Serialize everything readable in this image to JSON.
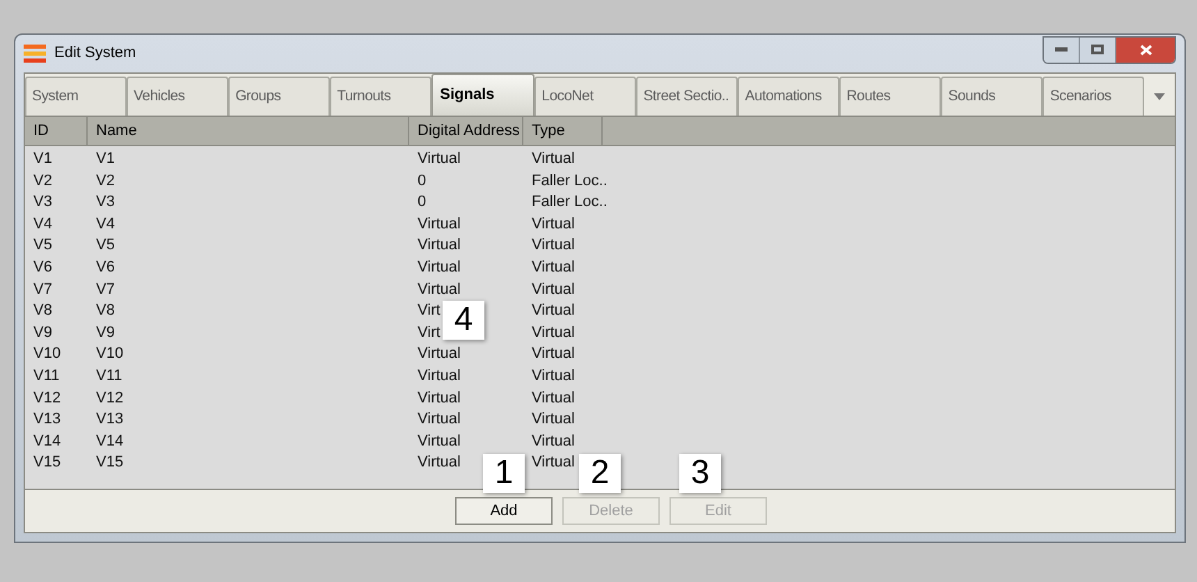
{
  "window": {
    "title": "Edit System"
  },
  "tabs": [
    {
      "label": "System",
      "selected": false
    },
    {
      "label": "Vehicles",
      "selected": false
    },
    {
      "label": "Groups",
      "selected": false
    },
    {
      "label": "Turnouts",
      "selected": false
    },
    {
      "label": "Signals",
      "selected": true
    },
    {
      "label": "LocoNet",
      "selected": false
    },
    {
      "label": "Street Sectio..",
      "selected": false
    },
    {
      "label": "Automations",
      "selected": false
    },
    {
      "label": "Routes",
      "selected": false
    },
    {
      "label": "Sounds",
      "selected": false
    },
    {
      "label": "Scenarios",
      "selected": false
    }
  ],
  "table": {
    "columns": [
      "ID",
      "Name",
      "Digital Address",
      "Type"
    ],
    "rows": [
      [
        "V1",
        "V1",
        "Virtual",
        "Virtual"
      ],
      [
        "V2",
        "V2",
        "0",
        "Faller Loc.."
      ],
      [
        "V3",
        "V3",
        "0",
        "Faller Loc.."
      ],
      [
        "V4",
        "V4",
        "Virtual",
        "Virtual"
      ],
      [
        "V5",
        "V5",
        "Virtual",
        "Virtual"
      ],
      [
        "V6",
        "V6",
        "Virtual",
        "Virtual"
      ],
      [
        "V7",
        "V7",
        "Virtual",
        "Virtual"
      ],
      [
        "V8",
        "V8",
        "Virt",
        "Virtual"
      ],
      [
        "V9",
        "V9",
        "Virt",
        "Virtual"
      ],
      [
        "V10",
        "V10",
        "Virtual",
        "Virtual"
      ],
      [
        "V11",
        "V11",
        "Virtual",
        "Virtual"
      ],
      [
        "V12",
        "V12",
        "Virtual",
        "Virtual"
      ],
      [
        "V13",
        "V13",
        "Virtual",
        "Virtual"
      ],
      [
        "V14",
        "V14",
        "Virtual",
        "Virtual"
      ],
      [
        "V15",
        "V15",
        "Virtual",
        "Virtual"
      ]
    ]
  },
  "buttons": [
    {
      "label": "Add",
      "disabled": false
    },
    {
      "label": "Delete",
      "disabled": true
    },
    {
      "label": "Edit",
      "disabled": true
    }
  ],
  "callouts": [
    "4",
    "1",
    "2",
    "3"
  ]
}
